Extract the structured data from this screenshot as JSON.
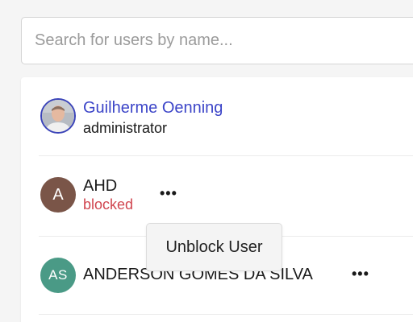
{
  "search": {
    "placeholder": "Search for users by name..."
  },
  "users": [
    {
      "name": "Guilherme Oenning",
      "role": "administrator",
      "avatar_type": "photo",
      "name_color": "#3c45c8"
    },
    {
      "name": "AHD",
      "role": "blocked",
      "avatar_initials": "A",
      "avatar_color": "#7a5548",
      "role_color": "#d0454f",
      "more_icon": "ellipsis-icon"
    },
    {
      "name": "ANDERSON GOMES DA SILVA",
      "avatar_initials": "AS",
      "avatar_color": "#4a9a86",
      "more_icon": "ellipsis-icon"
    }
  ],
  "context_menu": {
    "items": [
      {
        "label": "Unblock User"
      }
    ]
  }
}
